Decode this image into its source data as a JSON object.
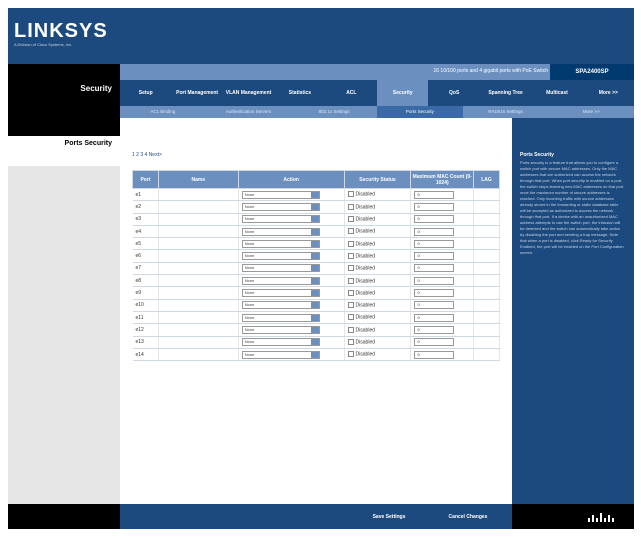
{
  "brand": {
    "logo": "LINKSYS",
    "logo_sub": "A Division of Cisco Systems, Inc."
  },
  "header": {
    "section_title": "Security",
    "model_text": "16 10/100 ports and 4 gigabit ports with PoE Switch",
    "model_id": "SPA2400SP"
  },
  "nav": {
    "items": [
      {
        "label": "Setup"
      },
      {
        "label": "Port Management"
      },
      {
        "label": "VLAN Management"
      },
      {
        "label": "Statistics"
      },
      {
        "label": "ACL"
      },
      {
        "label": "Security"
      },
      {
        "label": "QoS"
      },
      {
        "label": "Spanning Tree"
      },
      {
        "label": "Multicast"
      },
      {
        "label": "More >>"
      }
    ],
    "sub_items": [
      {
        "label": "ACL Binding"
      },
      {
        "label": "Authentication Servers"
      },
      {
        "label": "802.1x Settings"
      },
      {
        "label": "Ports Security"
      },
      {
        "label": "RADIUS Settings"
      },
      {
        "label": "More >>"
      }
    ]
  },
  "sidebar": {
    "page_title": "Ports Security"
  },
  "pager": "1 2 3 4  Next>",
  "table": {
    "headers": [
      "Port",
      "Name",
      "Action",
      "Security Status",
      "Maximum MAC Count (0-1024)",
      "LAG"
    ],
    "rows": [
      {
        "port": "e1",
        "action": "None",
        "status": "Disabled",
        "max": "0"
      },
      {
        "port": "e2",
        "action": "None",
        "status": "Disabled",
        "max": "0"
      },
      {
        "port": "e3",
        "action": "None",
        "status": "Disabled",
        "max": "0"
      },
      {
        "port": "e4",
        "action": "None",
        "status": "Disabled",
        "max": "0"
      },
      {
        "port": "e5",
        "action": "None",
        "status": "Disabled",
        "max": "0"
      },
      {
        "port": "e6",
        "action": "None",
        "status": "Disabled",
        "max": "0"
      },
      {
        "port": "e7",
        "action": "None",
        "status": "Disabled",
        "max": "0"
      },
      {
        "port": "e8",
        "action": "None",
        "status": "Disabled",
        "max": "0"
      },
      {
        "port": "e9",
        "action": "None",
        "status": "Disabled",
        "max": "0"
      },
      {
        "port": "e10",
        "action": "None",
        "status": "Disabled",
        "max": "0"
      },
      {
        "port": "e11",
        "action": "None",
        "status": "Disabled",
        "max": "0"
      },
      {
        "port": "e12",
        "action": "None",
        "status": "Disabled",
        "max": "0"
      },
      {
        "port": "e13",
        "action": "None",
        "status": "Disabled",
        "max": "0"
      },
      {
        "port": "e14",
        "action": "None",
        "status": "Disabled",
        "max": "0"
      }
    ]
  },
  "help": {
    "title": "Ports Security",
    "text": "Ports security is a feature that allows you to configure a switch port with secure MAC addresses. Only the MAC addresses that are authorized can access the network through that port. When port security is enabled on a port, the switch stops learning new MAC addresses on that port once the maximum number of secure addresses is reached. Only incoming traffic with source addresses already stored in the forwarding or static database table will be accepted as authorized to access the network through that port. If a device with an unauthorized MAC address attempts to use the switch port, the intrusion will be detected and the switch can automatically take action by disabling the port and sending a trap message. Note that when a port is disabled, click Ready for Security Enabled, the port will be enabled on the Port Configuration screen."
  },
  "buttons": {
    "save": "Save Settings",
    "cancel": "Cancel Changes"
  },
  "colors": {
    "primary": "#1d4a7e",
    "secondary": "#6b90c0"
  }
}
